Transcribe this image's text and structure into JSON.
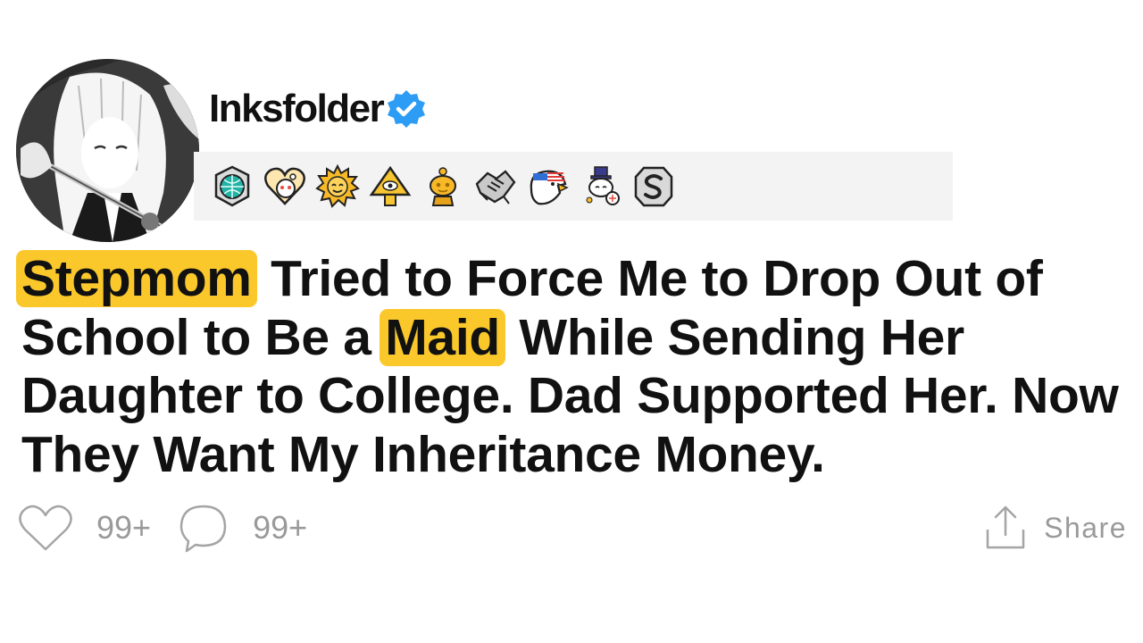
{
  "post": {
    "username": "Inksfolder",
    "verified": true,
    "title_segments": {
      "s0": "Stepmom",
      "s1": " Tried to Force Me to Drop Out of School to Be a ",
      "s2": "Maid",
      "s3": " While Sending Her Daughter to College. Dad Supported Her. Now They Want My Inheritance Money."
    }
  },
  "awards": [
    "globe-award-icon",
    "snoo-heart-award-icon",
    "sun-award-icon",
    "pyramid-eye-award-icon",
    "gold-snoo-award-icon",
    "handshake-award-icon",
    "eagle-award-icon",
    "snoo-tophat-award-icon",
    "silver-s-award-icon"
  ],
  "actions": {
    "like_count": "99+",
    "comment_count": "99+",
    "share_label": "Share"
  },
  "colors": {
    "highlight": "#fbc82c",
    "verified_badge": "#2d9cf5",
    "muted": "#9a9a9a",
    "award_bar": "#f3f3f3"
  }
}
